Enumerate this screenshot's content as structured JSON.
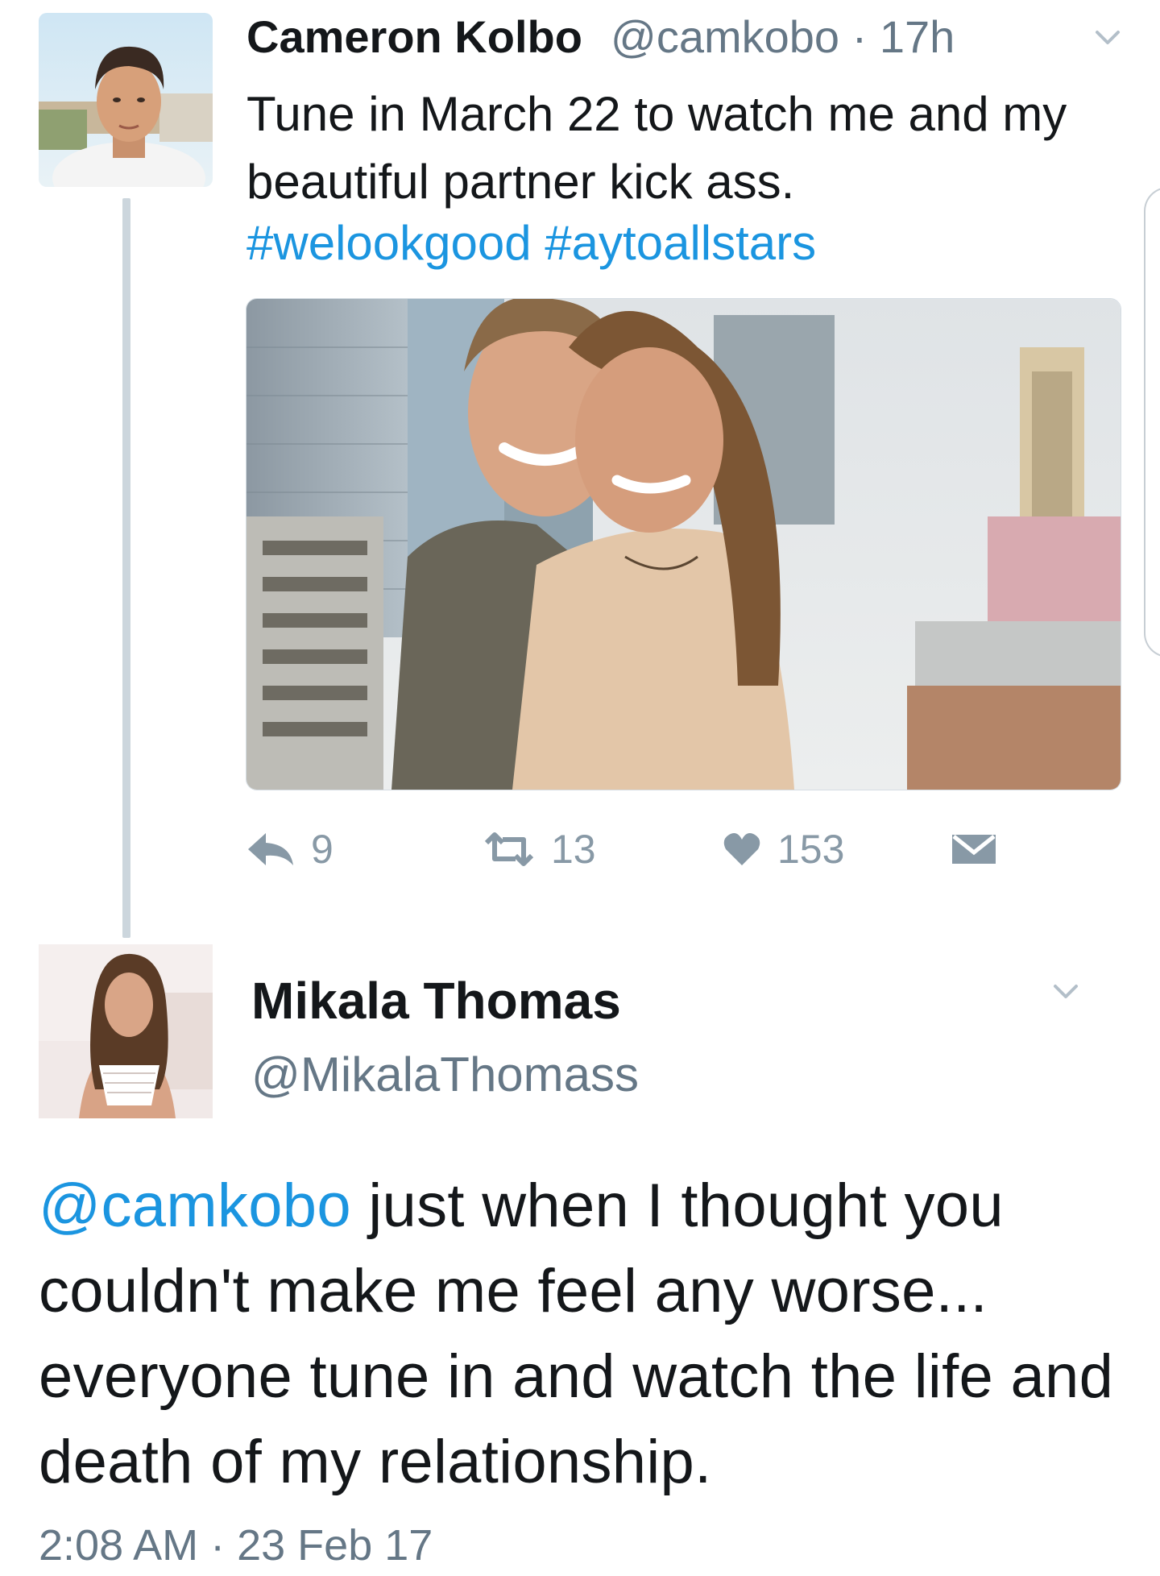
{
  "tweet1": {
    "author_name": "Cameron Kolbo",
    "author_handle": "@camkobo",
    "separator": "·",
    "time": "17h",
    "text": "Tune in March 22 to watch me and my beautiful partner kick ass.",
    "hashtags": [
      "#welookgood",
      "#aytoallstars"
    ],
    "photo_icon": "photo-couple-city-rooftop",
    "actions": {
      "reply_icon": "reply-icon",
      "reply_count": "9",
      "retweet_icon": "retweet-icon",
      "retweet_count": "13",
      "like_icon": "heart-icon",
      "like_count": "153",
      "dm_icon": "envelope-icon"
    }
  },
  "tweet2": {
    "author_name": "Mikala Thomas",
    "author_handle": "@MikalaThomass",
    "mention": "@camkobo",
    "text": " just when I thought you couldn't make me feel any worse... everyone tune in and watch the life and death of my relationship.",
    "timestamp": "2:08 AM · 23 Feb 17"
  },
  "colors": {
    "link": "#1b95e0",
    "secondary_text": "#657786",
    "action_gray": "#8899a6",
    "thread_line": "#ccd6dd"
  }
}
